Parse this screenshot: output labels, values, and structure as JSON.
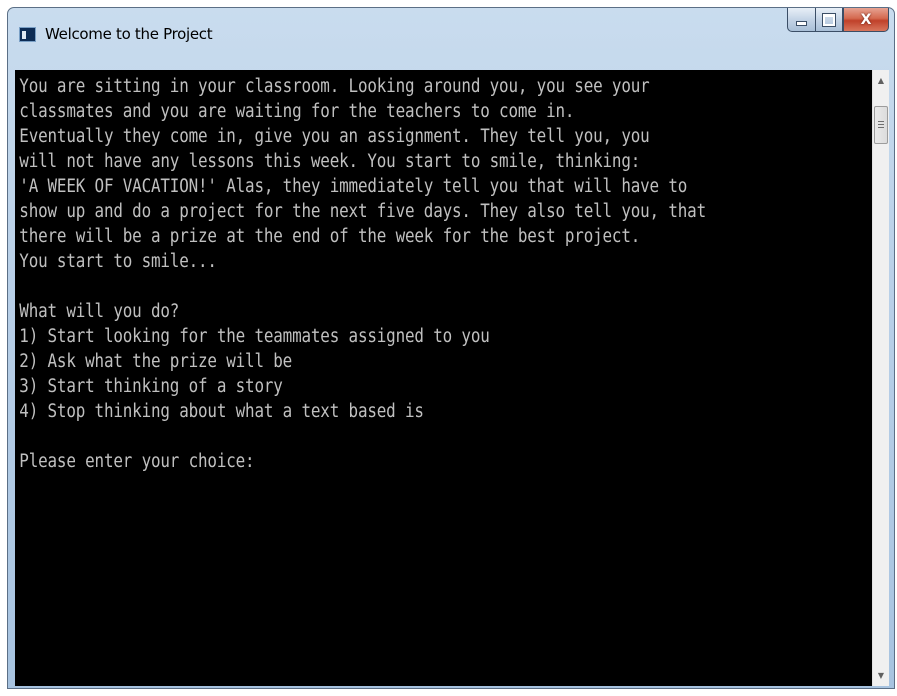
{
  "window": {
    "title": "Welcome to the Project",
    "close_label": "X"
  },
  "console": {
    "lines": [
      "You are sitting in your classroom. Looking around you, you see your",
      "classmates and you are waiting for the teachers to come in.",
      "Eventually they come in, give you an assignment. They tell you, you",
      "will not have any lessons this week. You start to smile, thinking:",
      "'A WEEK OF VACATION!' Alas, they immediately tell you that will have to",
      "show up and do a project for the next five days. They also tell you, that",
      "there will be a prize at the end of the week for the best project.",
      "You start to smile...",
      "",
      "What will you do?",
      "1) Start looking for the teammates assigned to you",
      "2) Ask what the prize will be",
      "3) Start thinking of a story",
      "4) Stop thinking about what a text based is",
      "",
      "Please enter your choice:"
    ]
  },
  "icons": {
    "window_icon": "console-window-icon",
    "minimize": "minimize-icon",
    "maximize": "maximize-icon",
    "close": "close-icon",
    "scroll_up": "scroll-up-arrow-icon",
    "scroll_down": "scroll-down-arrow-icon"
  },
  "colors": {
    "console_background": "#000000",
    "console_text": "#c0c0c0",
    "close_button": "#c0412a"
  }
}
